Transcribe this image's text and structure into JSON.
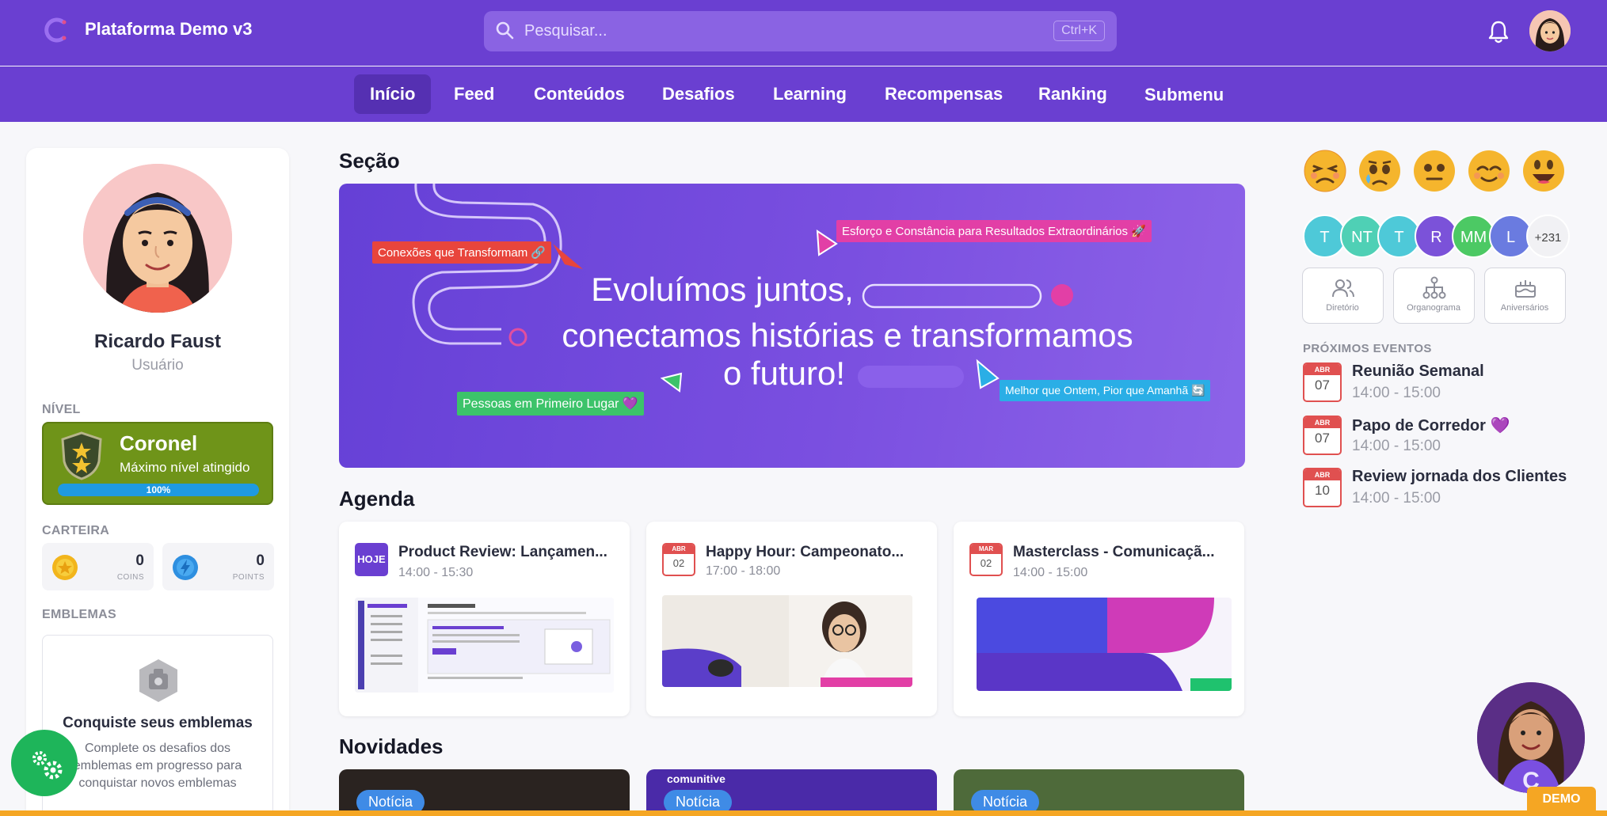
{
  "header": {
    "brand": "Plataforma Demo v3",
    "search_placeholder": "Pesquisar...",
    "search_shortcut": "Ctrl+K",
    "icons": {
      "logo": "comunitive-logo-icon",
      "search": "search-icon",
      "notifications": "bell-icon",
      "avatar": "user-avatar"
    }
  },
  "nav": {
    "items": [
      {
        "label": "Início",
        "active": true
      },
      {
        "label": "Feed"
      },
      {
        "label": "Conteúdos"
      },
      {
        "label": "Desafios"
      },
      {
        "label": "Learning"
      },
      {
        "label": "Recompensas"
      },
      {
        "label": "Ranking"
      },
      {
        "label": "Submenu"
      }
    ]
  },
  "profile": {
    "name": "Ricardo Faust",
    "role": "Usuário",
    "level_label": "NÍVEL",
    "level_title": "Coronel",
    "level_subtitle": "Máximo nível atingido",
    "level_progress": "100%",
    "wallet_label": "CARTEIRA",
    "coins_value": "0",
    "coins_unit": "COINS",
    "points_value": "0",
    "points_unit": "POINTS",
    "badges_label": "EMBLEMAS",
    "badges_title": "Conquiste seus emblemas",
    "badges_desc": "Complete os desafios dos emblemas em progresso para conquistar novos emblemas"
  },
  "main": {
    "section_title": "Seção",
    "banner": {
      "line1": "Evoluímos juntos,",
      "line2": "conectamos histórias e transformamos",
      "line3": "o futuro!",
      "tags": [
        "Conexões que Transformam 🔗",
        "Esforço e Constância para Resultados Extraordinários 🚀",
        "Pessoas em Primeiro Lugar 💜",
        "Melhor que Ontem, Pior que Amanhã 🔄"
      ]
    },
    "agenda_title": "Agenda",
    "agenda": [
      {
        "badge": "HOJE",
        "month": "",
        "day": "",
        "title": "Product Review: Lançamen...",
        "time": "14:00 - 15:30"
      },
      {
        "badge": "",
        "month": "ABR",
        "day": "02",
        "title": "Happy Hour: Campeonato...",
        "time": "17:00 - 18:00"
      },
      {
        "badge": "",
        "month": "MAR",
        "day": "02",
        "title": "Masterclass - Comunicaçã...",
        "time": "14:00 - 15:00"
      }
    ],
    "news_title": "Novidades",
    "news": [
      {
        "tag": "Notícia"
      },
      {
        "tag": "Notícia",
        "brand": "comunitive"
      },
      {
        "tag": "Notícia"
      }
    ]
  },
  "right": {
    "mood_emojis": [
      "😣",
      "😢",
      "😐",
      "😌",
      "😃"
    ],
    "members": [
      {
        "initials": "T",
        "color": "#4ec9d8"
      },
      {
        "initials": "NT",
        "color": "#4fd0b5"
      },
      {
        "initials": "T",
        "color": "#4ec9d8"
      },
      {
        "initials": "R",
        "color": "#7b52d9"
      },
      {
        "initials": "MM",
        "color": "#4cc964"
      },
      {
        "initials": "L",
        "color": "#6a7be0"
      }
    ],
    "members_more": "+231",
    "quick_links": [
      {
        "label": "Diretório",
        "icon": "users-icon"
      },
      {
        "label": "Organograma",
        "icon": "org-chart-icon"
      },
      {
        "label": "Aniversários",
        "icon": "cake-icon"
      }
    ],
    "events_label": "PRÓXIMOS EVENTOS",
    "events": [
      {
        "month": "ABR",
        "day": "07",
        "title": "Reunião Semanal",
        "time": "14:00 - 15:00"
      },
      {
        "month": "ABR",
        "day": "07",
        "title": "Papo de Corredor 💜",
        "time": "14:00 - 15:00"
      },
      {
        "month": "ABR",
        "day": "10",
        "title": "Review jornada dos Clientes",
        "time": "14:00 - 15:00"
      }
    ]
  },
  "misc": {
    "demo_label": "DEMO",
    "fab_icon": "settings-gears-icon",
    "mascot": "mascot-avatar"
  }
}
